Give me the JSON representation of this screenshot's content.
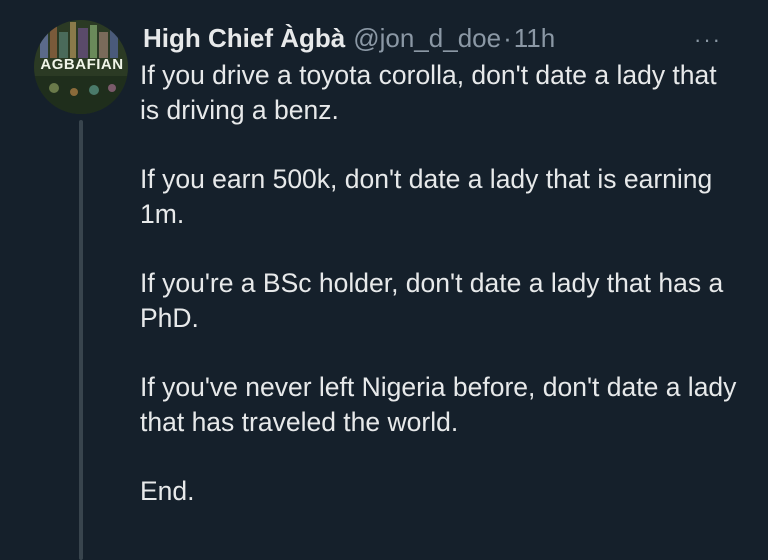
{
  "tweet": {
    "author_name": "High Chief Àgbà",
    "handle": "@jon_d_doe",
    "separator": "·",
    "time": "11h",
    "more_label": "···",
    "avatar_text": "AGBAFIAN",
    "paragraphs": [
      "If you drive a toyota corolla, don't date a lady that is driving a benz.",
      "If you earn 500k, don't date a lady that is earning 1m.",
      "If you're a BSc holder, don't date a lady that has a PhD.",
      "If you've never left Nigeria before, don't date a lady that has traveled the world.",
      "End."
    ]
  }
}
